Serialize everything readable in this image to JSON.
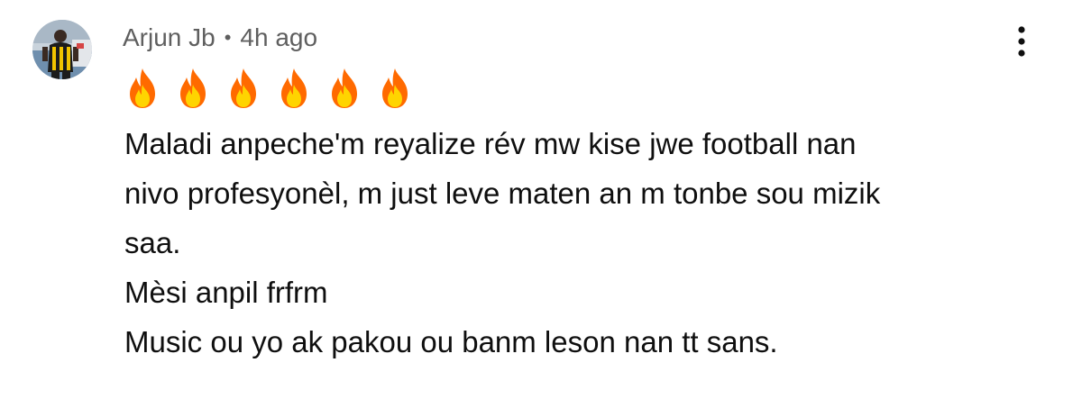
{
  "comment": {
    "author": "Arjun Jb",
    "separator": "•",
    "time": "4h ago",
    "reaction_emoji": [
      "🔥",
      "🔥",
      "🔥",
      "🔥",
      "🔥",
      "🔥"
    ],
    "lines": [
      "Maladi anpeche'm reyalize rév mw kise jwe football nan",
      "nivo profesyonèl, m just leve maten an m tonbe sou mizik",
      "saa.",
      "Mèsi anpil frfrm",
      "Music ou yo ak pakou ou banm leson nan tt sans."
    ],
    "menu_icon": "more-vert-icon",
    "avatar_icon": "user-avatar"
  },
  "colors": {
    "meta_text": "#5f5f5f",
    "body_text": "#0f0f0f",
    "background": "#ffffff",
    "fire_outer": "#ff6a00",
    "fire_inner": "#ffd400"
  }
}
